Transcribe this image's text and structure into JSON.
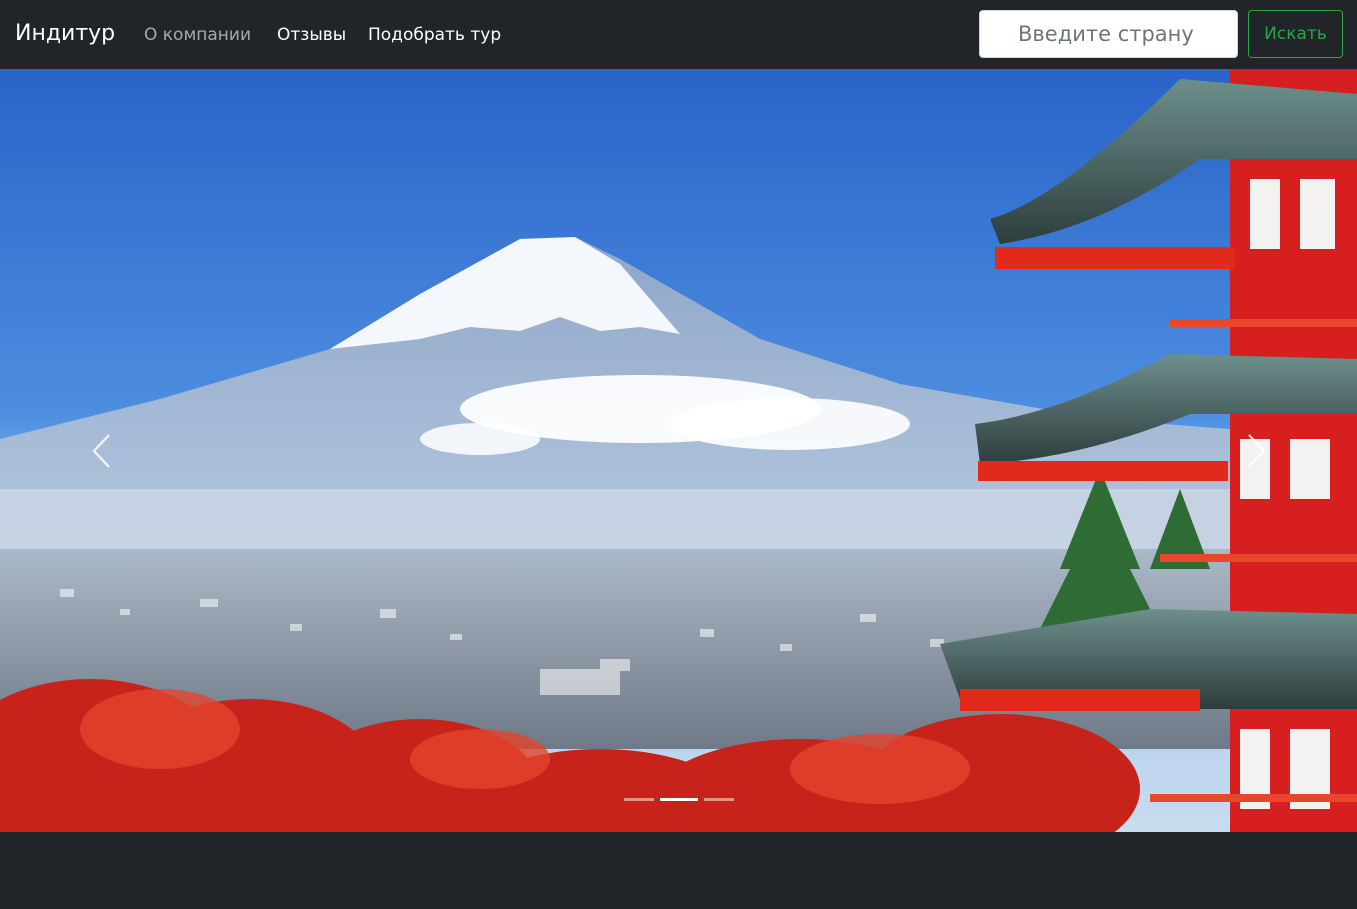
{
  "navbar": {
    "brand": "Индитур",
    "links": [
      {
        "label": "О компании",
        "state": "muted"
      },
      {
        "label": "Отзывы",
        "state": "normal"
      },
      {
        "label": "Подобрать тур",
        "state": "normal"
      }
    ],
    "search": {
      "placeholder": "Введите страну",
      "value": ""
    },
    "search_button": "Искать"
  },
  "carousel": {
    "prev_icon": "chevron-left-icon",
    "next_icon": "chevron-right-icon",
    "indicator_count": 3,
    "active_index": 1
  },
  "colors": {
    "navbar_bg": "#212529",
    "search_accent": "#28a745"
  }
}
